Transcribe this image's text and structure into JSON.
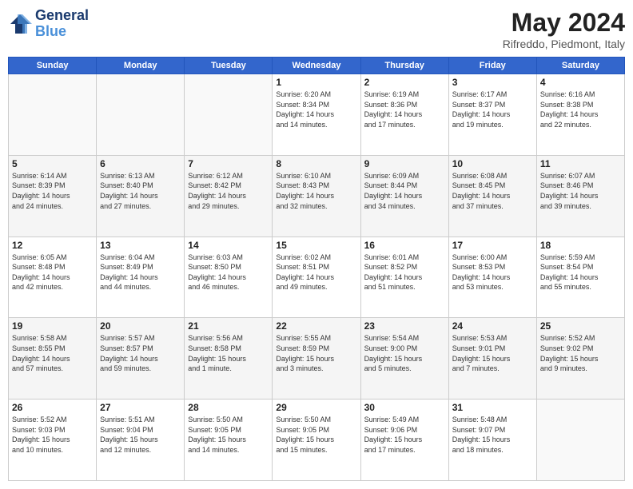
{
  "header": {
    "logo_line1": "General",
    "logo_line2": "Blue",
    "month": "May 2024",
    "location": "Rifreddo, Piedmont, Italy"
  },
  "weekdays": [
    "Sunday",
    "Monday",
    "Tuesday",
    "Wednesday",
    "Thursday",
    "Friday",
    "Saturday"
  ],
  "weeks": [
    [
      {
        "day": "",
        "info": ""
      },
      {
        "day": "",
        "info": ""
      },
      {
        "day": "",
        "info": ""
      },
      {
        "day": "1",
        "info": "Sunrise: 6:20 AM\nSunset: 8:34 PM\nDaylight: 14 hours\nand 14 minutes."
      },
      {
        "day": "2",
        "info": "Sunrise: 6:19 AM\nSunset: 8:36 PM\nDaylight: 14 hours\nand 17 minutes."
      },
      {
        "day": "3",
        "info": "Sunrise: 6:17 AM\nSunset: 8:37 PM\nDaylight: 14 hours\nand 19 minutes."
      },
      {
        "day": "4",
        "info": "Sunrise: 6:16 AM\nSunset: 8:38 PM\nDaylight: 14 hours\nand 22 minutes."
      }
    ],
    [
      {
        "day": "5",
        "info": "Sunrise: 6:14 AM\nSunset: 8:39 PM\nDaylight: 14 hours\nand 24 minutes."
      },
      {
        "day": "6",
        "info": "Sunrise: 6:13 AM\nSunset: 8:40 PM\nDaylight: 14 hours\nand 27 minutes."
      },
      {
        "day": "7",
        "info": "Sunrise: 6:12 AM\nSunset: 8:42 PM\nDaylight: 14 hours\nand 29 minutes."
      },
      {
        "day": "8",
        "info": "Sunrise: 6:10 AM\nSunset: 8:43 PM\nDaylight: 14 hours\nand 32 minutes."
      },
      {
        "day": "9",
        "info": "Sunrise: 6:09 AM\nSunset: 8:44 PM\nDaylight: 14 hours\nand 34 minutes."
      },
      {
        "day": "10",
        "info": "Sunrise: 6:08 AM\nSunset: 8:45 PM\nDaylight: 14 hours\nand 37 minutes."
      },
      {
        "day": "11",
        "info": "Sunrise: 6:07 AM\nSunset: 8:46 PM\nDaylight: 14 hours\nand 39 minutes."
      }
    ],
    [
      {
        "day": "12",
        "info": "Sunrise: 6:05 AM\nSunset: 8:48 PM\nDaylight: 14 hours\nand 42 minutes."
      },
      {
        "day": "13",
        "info": "Sunrise: 6:04 AM\nSunset: 8:49 PM\nDaylight: 14 hours\nand 44 minutes."
      },
      {
        "day": "14",
        "info": "Sunrise: 6:03 AM\nSunset: 8:50 PM\nDaylight: 14 hours\nand 46 minutes."
      },
      {
        "day": "15",
        "info": "Sunrise: 6:02 AM\nSunset: 8:51 PM\nDaylight: 14 hours\nand 49 minutes."
      },
      {
        "day": "16",
        "info": "Sunrise: 6:01 AM\nSunset: 8:52 PM\nDaylight: 14 hours\nand 51 minutes."
      },
      {
        "day": "17",
        "info": "Sunrise: 6:00 AM\nSunset: 8:53 PM\nDaylight: 14 hours\nand 53 minutes."
      },
      {
        "day": "18",
        "info": "Sunrise: 5:59 AM\nSunset: 8:54 PM\nDaylight: 14 hours\nand 55 minutes."
      }
    ],
    [
      {
        "day": "19",
        "info": "Sunrise: 5:58 AM\nSunset: 8:55 PM\nDaylight: 14 hours\nand 57 minutes."
      },
      {
        "day": "20",
        "info": "Sunrise: 5:57 AM\nSunset: 8:57 PM\nDaylight: 14 hours\nand 59 minutes."
      },
      {
        "day": "21",
        "info": "Sunrise: 5:56 AM\nSunset: 8:58 PM\nDaylight: 15 hours\nand 1 minute."
      },
      {
        "day": "22",
        "info": "Sunrise: 5:55 AM\nSunset: 8:59 PM\nDaylight: 15 hours\nand 3 minutes."
      },
      {
        "day": "23",
        "info": "Sunrise: 5:54 AM\nSunset: 9:00 PM\nDaylight: 15 hours\nand 5 minutes."
      },
      {
        "day": "24",
        "info": "Sunrise: 5:53 AM\nSunset: 9:01 PM\nDaylight: 15 hours\nand 7 minutes."
      },
      {
        "day": "25",
        "info": "Sunrise: 5:52 AM\nSunset: 9:02 PM\nDaylight: 15 hours\nand 9 minutes."
      }
    ],
    [
      {
        "day": "26",
        "info": "Sunrise: 5:52 AM\nSunset: 9:03 PM\nDaylight: 15 hours\nand 10 minutes."
      },
      {
        "day": "27",
        "info": "Sunrise: 5:51 AM\nSunset: 9:04 PM\nDaylight: 15 hours\nand 12 minutes."
      },
      {
        "day": "28",
        "info": "Sunrise: 5:50 AM\nSunset: 9:05 PM\nDaylight: 15 hours\nand 14 minutes."
      },
      {
        "day": "29",
        "info": "Sunrise: 5:50 AM\nSunset: 9:05 PM\nDaylight: 15 hours\nand 15 minutes."
      },
      {
        "day": "30",
        "info": "Sunrise: 5:49 AM\nSunset: 9:06 PM\nDaylight: 15 hours\nand 17 minutes."
      },
      {
        "day": "31",
        "info": "Sunrise: 5:48 AM\nSunset: 9:07 PM\nDaylight: 15 hours\nand 18 minutes."
      },
      {
        "day": "",
        "info": ""
      }
    ]
  ]
}
